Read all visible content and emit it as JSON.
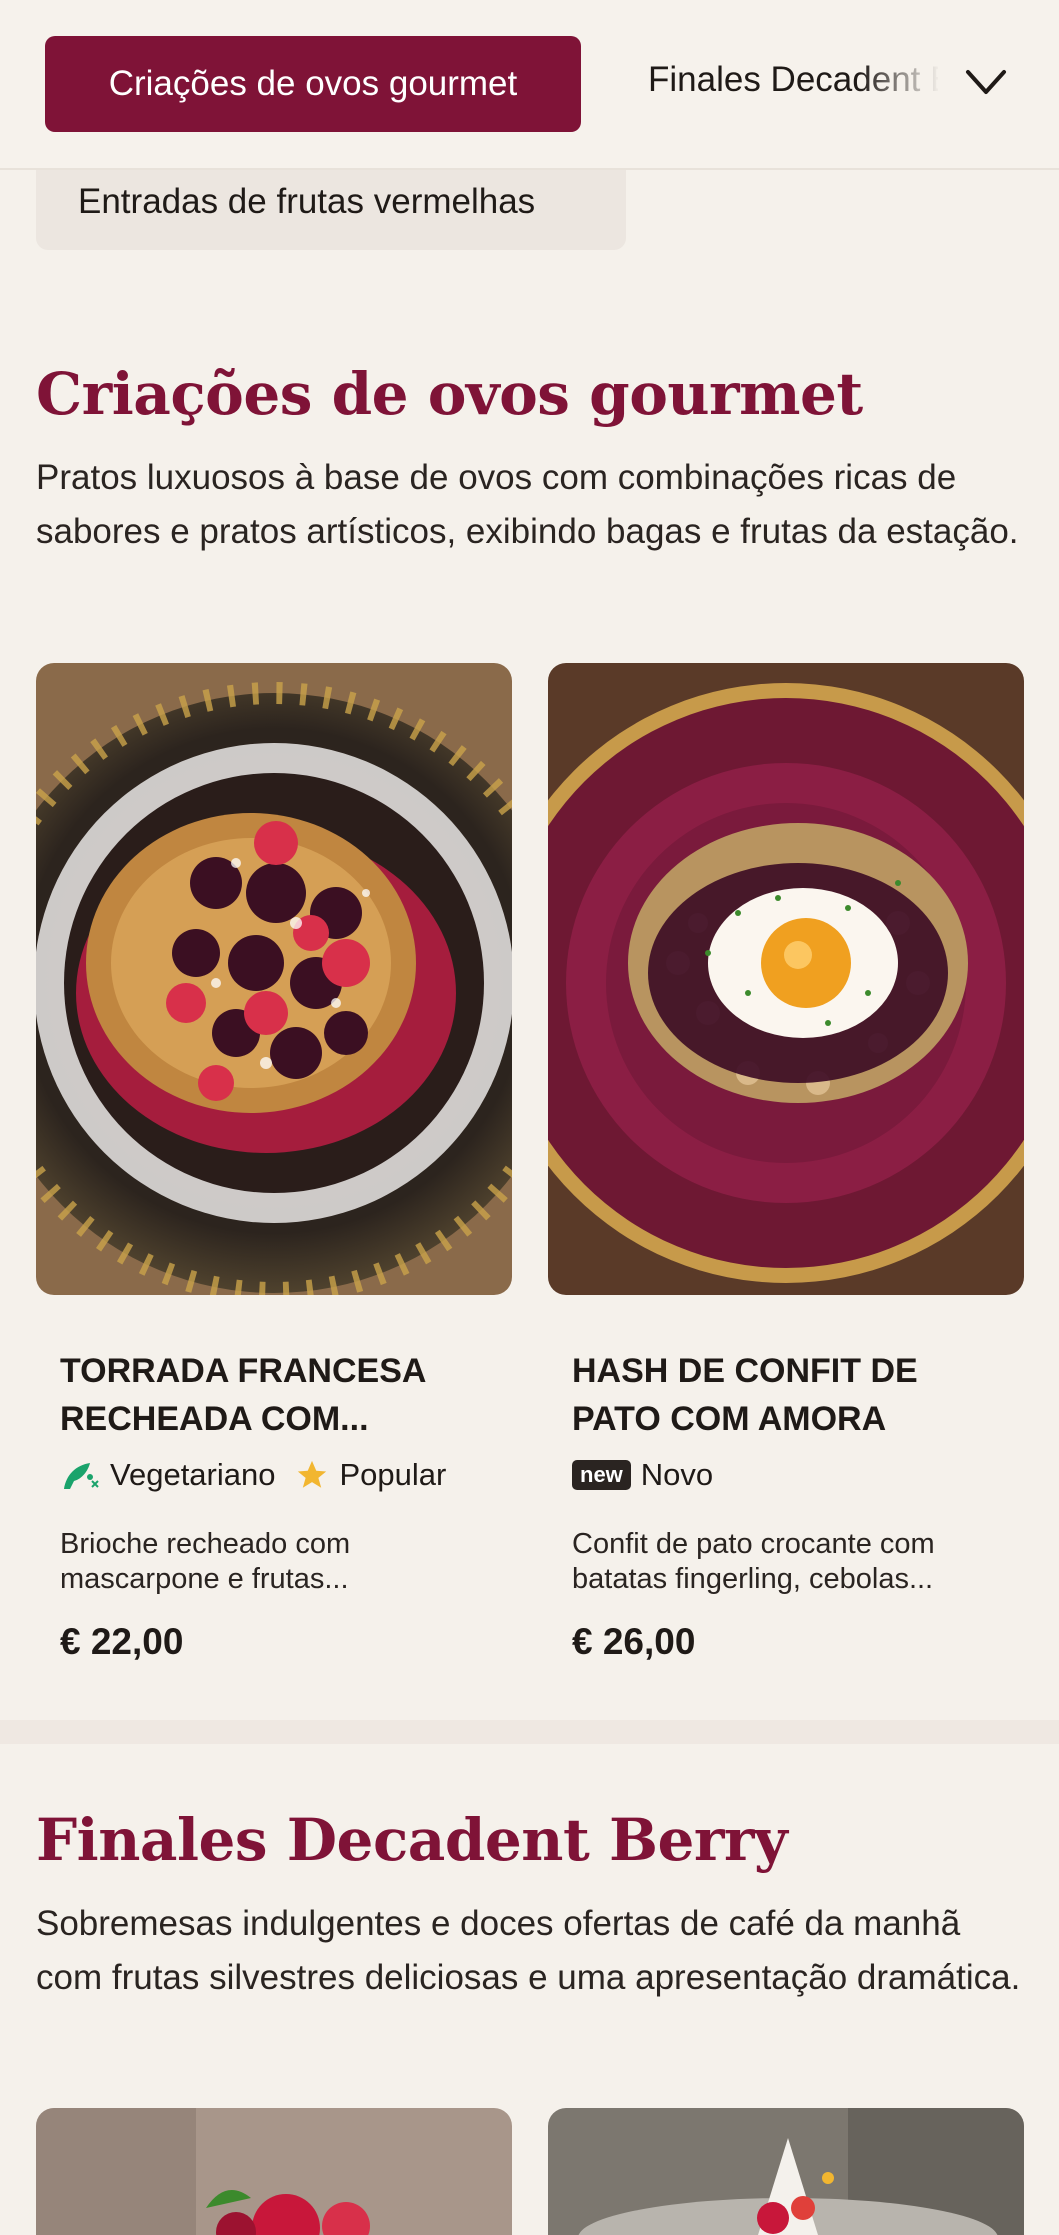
{
  "nav": {
    "active_tab": "Criações de ovos gourmet",
    "next_tab": "Finales Decadent Berry",
    "secondary_tab": "Entradas de frutas vermelhas"
  },
  "sections": [
    {
      "title": "Criações de ovos gourmet",
      "description": "Pratos luxuosos à base de ovos com combinações ricas de sabores e pratos artísticos, exibindo bagas e frutas da estação.",
      "items": [
        {
          "title": "TORRADA FRANCESA RECHEADA COM...",
          "tags": [
            "Vegetariano",
            "Popular"
          ],
          "description": "Brioche recheado com mascarpone e frutas...",
          "price": "€ 22,00"
        },
        {
          "title": "HASH DE CONFIT DE PATO COM AMORA",
          "badge": "new",
          "tags": [
            "Novo"
          ],
          "description": "Confit de pato crocante com batatas fingerling, cebolas...",
          "price": "€ 26,00"
        }
      ]
    },
    {
      "title": "Finales Decadent Berry",
      "description": "Sobremesas indulgentes e doces ofertas de café da manhã com frutas silvestres deliciosas e uma apresentação dramática."
    }
  ],
  "colors": {
    "accent": "#7f1337",
    "background": "#f5f1eb",
    "veg": "#1aa36b",
    "star": "#f2b630"
  }
}
